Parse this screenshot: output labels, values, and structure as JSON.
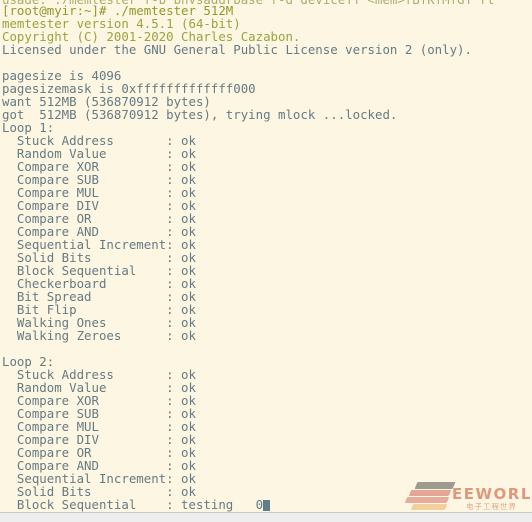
{
  "terminal": {
    "background_color": "#fdf6e3",
    "default_text_color": "#657b83",
    "prompt_color": "#8f9a2c",
    "cursor_color": "#5f7d8c",
    "lines": [
      {
        "text": "usage: ./memtester [-p physaddrbase [-d device]] <mem>[B|K|M|G] [l",
        "style": "cut"
      },
      {
        "text": "[root@myir:~]# ./memtester 512M",
        "style": "prompt"
      },
      {
        "text": "memtester version 4.5.1 (64-bit)",
        "style": "olive"
      },
      {
        "text": "Copyright (C) 2001-2020 Charles Cazabon.",
        "style": "olive"
      },
      {
        "text": "Licensed under the GNU General Public License version 2 (only).",
        "style": "normal"
      },
      {
        "text": "",
        "style": "blank"
      },
      {
        "text": "pagesize is 4096",
        "style": "normal"
      },
      {
        "text": "pagesizemask is 0xfffffffffffff000",
        "style": "normal"
      },
      {
        "text": "want 512MB (536870912 bytes)",
        "style": "normal"
      },
      {
        "text": "got  512MB (536870912 bytes), trying mlock ...locked.",
        "style": "normal"
      },
      {
        "text": "Loop 1:",
        "style": "normal"
      },
      {
        "text": "  Stuck Address       : ok",
        "style": "normal"
      },
      {
        "text": "  Random Value        : ok",
        "style": "normal"
      },
      {
        "text": "  Compare XOR         : ok",
        "style": "normal"
      },
      {
        "text": "  Compare SUB         : ok",
        "style": "normal"
      },
      {
        "text": "  Compare MUL         : ok",
        "style": "normal"
      },
      {
        "text": "  Compare DIV         : ok",
        "style": "normal"
      },
      {
        "text": "  Compare OR          : ok",
        "style": "normal"
      },
      {
        "text": "  Compare AND         : ok",
        "style": "normal"
      },
      {
        "text": "  Sequential Increment: ok",
        "style": "normal"
      },
      {
        "text": "  Solid Bits          : ok",
        "style": "normal"
      },
      {
        "text": "  Block Sequential    : ok",
        "style": "normal"
      },
      {
        "text": "  Checkerboard        : ok",
        "style": "normal"
      },
      {
        "text": "  Bit Spread          : ok",
        "style": "normal"
      },
      {
        "text": "  Bit Flip            : ok",
        "style": "normal"
      },
      {
        "text": "  Walking Ones        : ok",
        "style": "normal"
      },
      {
        "text": "  Walking Zeroes      : ok",
        "style": "normal"
      },
      {
        "text": "",
        "style": "blank"
      },
      {
        "text": "Loop 2:",
        "style": "normal"
      },
      {
        "text": "  Stuck Address       : ok",
        "style": "normal"
      },
      {
        "text": "  Random Value        : ok",
        "style": "normal"
      },
      {
        "text": "  Compare XOR         : ok",
        "style": "normal"
      },
      {
        "text": "  Compare SUB         : ok",
        "style": "normal"
      },
      {
        "text": "  Compare MUL         : ok",
        "style": "normal"
      },
      {
        "text": "  Compare DIV         : ok",
        "style": "normal"
      },
      {
        "text": "  Compare OR          : ok",
        "style": "normal"
      },
      {
        "text": "  Compare AND         : ok",
        "style": "normal"
      },
      {
        "text": "  Sequential Increment: ok",
        "style": "normal"
      },
      {
        "text": "  Solid Bits          : ok",
        "style": "normal"
      },
      {
        "text": "  Block Sequential    : testing   0",
        "style": "normal",
        "cursor": true
      }
    ]
  },
  "watermark": {
    "brand": "EEWORLD",
    "subtitle": "电子工程世界",
    "brand_color": "#d9886a"
  }
}
